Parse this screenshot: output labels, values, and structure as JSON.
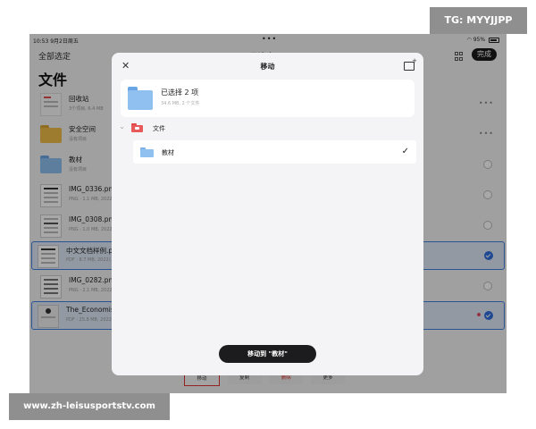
{
  "status_bar": {
    "time": "10:53",
    "date": "9月2日周五",
    "dots": "•••",
    "right": "95%"
  },
  "nav": {
    "left": "全部选定",
    "center": "已选定 2",
    "done": "完成"
  },
  "page_title": "文件",
  "files": [
    {
      "name": "回收站",
      "meta": "3个项目, 6.4 MB"
    },
    {
      "name": "安全空间",
      "meta": "没有项目"
    },
    {
      "name": "教材",
      "meta": "没有项目"
    },
    {
      "name": "IMG_0336.png",
      "meta": "PNG · 1.1 MB, 2022/..."
    },
    {
      "name": "IMG_0308.png",
      "meta": "PNG · 1.0 MB, 2022/..."
    },
    {
      "name": "中文文档样例.p",
      "meta": "PDF · 8.7 MB, 2022/..."
    },
    {
      "name": "IMG_0282.png",
      "meta": "PNG · 2.1 MB, 2022/..."
    },
    {
      "name": "The_Economist",
      "meta": "PDF · 25.8 MB, 2022/..."
    }
  ],
  "toolbar": {
    "move": "移动",
    "copy": "复制",
    "delete": "删除",
    "more": "更多"
  },
  "modal": {
    "title": "移动",
    "selected_title": "已选择 2 项",
    "selected_meta": "34.6 MB, 2 个文件",
    "root_folder": "文件",
    "target_folder": "教材",
    "move_button": "移动到 \"教材\""
  },
  "watermarks": {
    "top": "TG: MYYJJPP",
    "bottom": "www.zh-leisusportstv.com"
  },
  "colors": {
    "accent": "#2f6fde",
    "folder_blue": "#8fc0f0",
    "folder_red": "#e85a5a",
    "delete_red": "#e03535"
  }
}
